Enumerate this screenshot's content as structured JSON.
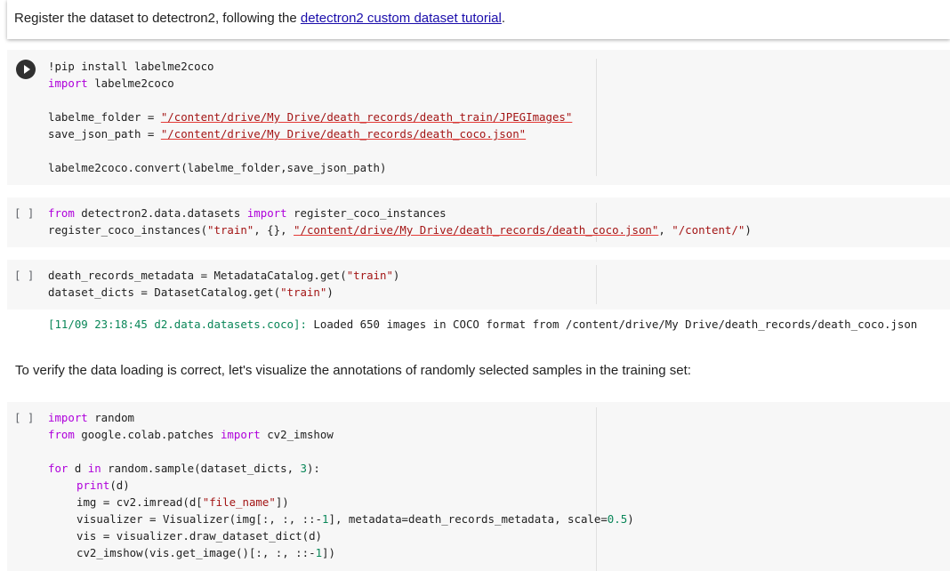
{
  "intro": {
    "text_before": "Register the dataset to detectron2, following the ",
    "link": "detectron2 custom dataset tutorial",
    "text_after": "."
  },
  "cell1": {
    "l1": "!pip install labelme2coco",
    "l2_kw": "import",
    "l2_rest": " labelme2coco",
    "l3_a": "labelme_folder = ",
    "l3_s": "\"/content/drive/My Drive/death_records/death_train/JPEGImages\"",
    "l4_a": "save_json_path = ",
    "l4_s": "\"/content/drive/My Drive/death_records/death_coco.json\"",
    "l5": "labelme2coco.convert(labelme_folder,save_json_path)"
  },
  "cell2": {
    "bracket": "[ ]",
    "l1_kw1": "from",
    "l1_mid": " detectron2.data.datasets ",
    "l1_kw2": "import",
    "l1_rest": " register_coco_instances",
    "l2_a": "register_coco_instances(",
    "l2_s1": "\"train\"",
    "l2_b": ", {}, ",
    "l2_s2": "\"/content/drive/My Drive/death_records/death_coco.json\"",
    "l2_c": ", ",
    "l2_s3": "\"/content/\"",
    "l2_d": ")"
  },
  "cell3": {
    "bracket": "[ ]",
    "l1_a": "death_records_metadata = MetadataCatalog.get(",
    "l1_s": "\"train\"",
    "l1_b": ")",
    "l2_a": "dataset_dicts = DatasetCatalog.get(",
    "l2_s": "\"train\"",
    "l2_b": ")",
    "output_prefix": "[11/09 23:18:45 d2.data.datasets.coco]:",
    "output_rest": " Loaded 650 images in COCO format from /content/drive/My Drive/death_records/death_coco.json"
  },
  "md2": {
    "text": "To verify the data loading is correct, let's visualize the annotations of randomly selected samples in the training set:"
  },
  "cell4": {
    "bracket": "[ ]",
    "l1_kw": "import",
    "l1_rest": " random",
    "l2_kw1": "from",
    "l2_mid": " google.colab.patches ",
    "l2_kw2": "import",
    "l2_rest": " cv2_imshow",
    "l3_kw1": "for",
    "l3_mid": " d ",
    "l3_kw2": "in",
    "l3_rest_a": " random.sample(dataset_dicts, ",
    "l3_num": "3",
    "l3_rest_b": "):",
    "l4_fn": "print",
    "l4_rest": "(d)",
    "l5_a": "img = cv2.imread(d[",
    "l5_s": "\"file_name\"",
    "l5_b": "])",
    "l6_a": "visualizer = Visualizer(img[:, :, ::-",
    "l6_n1": "1",
    "l6_b": "], metadata=death_records_metadata, scale=",
    "l6_n2": "0.5",
    "l6_c": ")",
    "l7": "vis = visualizer.draw_dataset_dict(d)",
    "l8_a": "cv2_imshow(vis.get_image()[:, :, ::-",
    "l8_n": "1",
    "l8_b": "])"
  },
  "colors": {
    "keyword": "#af00db",
    "string": "#a31515",
    "number": "#098658",
    "link": "#1a0dab",
    "code_bg": "#f7f7f7"
  }
}
